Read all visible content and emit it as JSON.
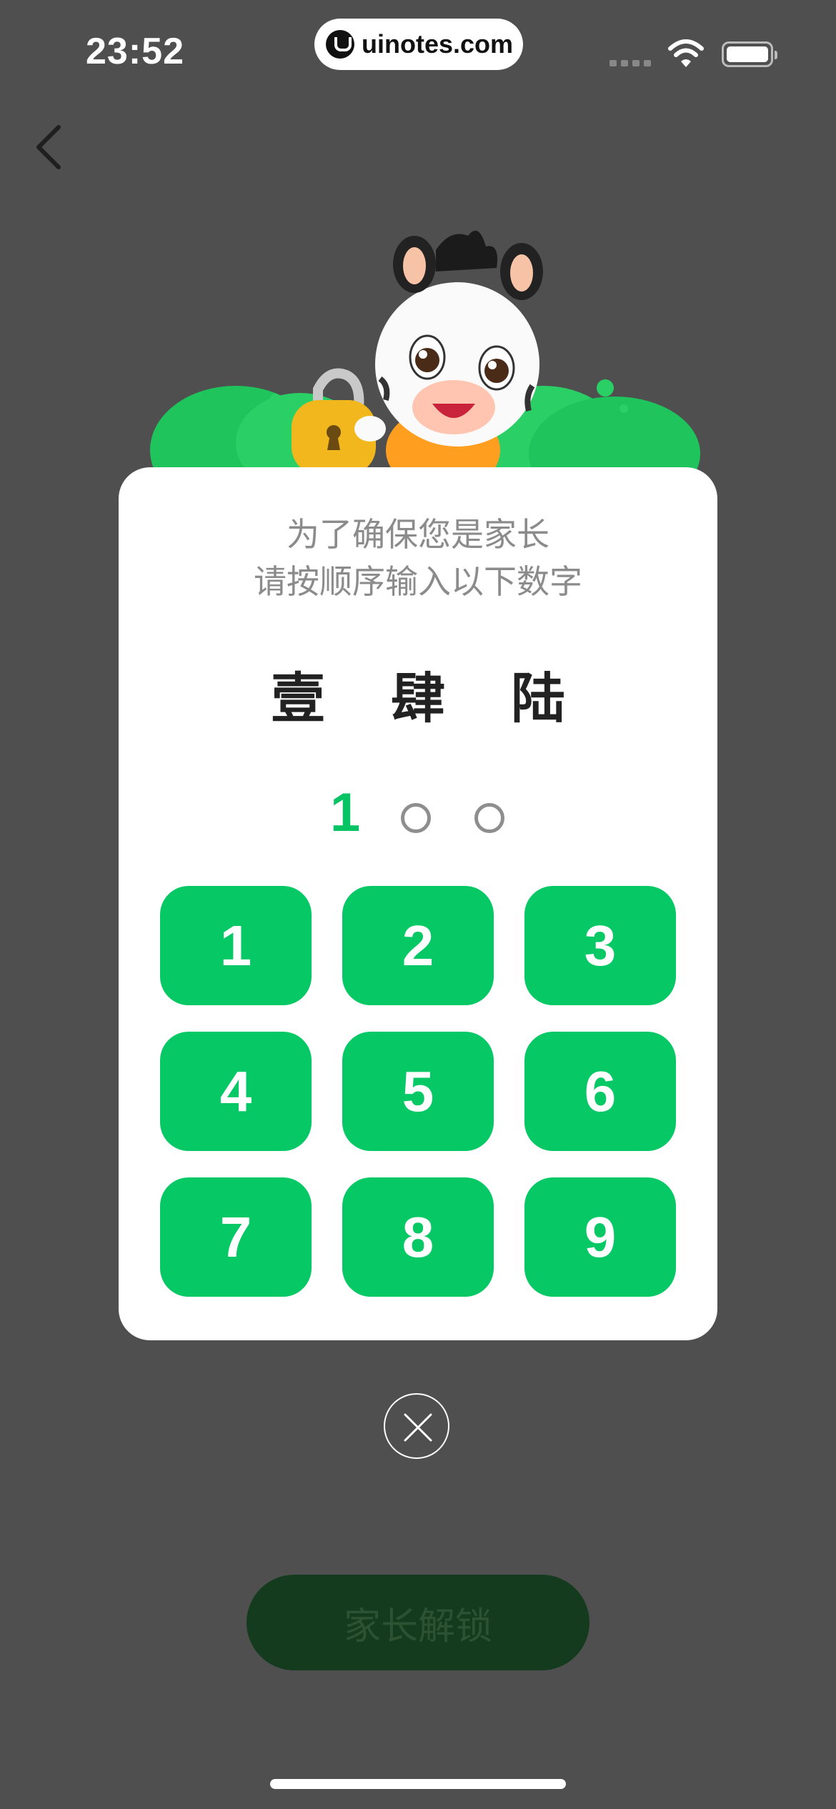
{
  "status_bar": {
    "time": "23:52",
    "url": "uinotes.com"
  },
  "prompt": {
    "line1": "为了确保您是家长",
    "line2": "请按顺序输入以下数字"
  },
  "challenge_chars": [
    "壹",
    "肆",
    "陆"
  ],
  "progress": {
    "entered_digit": "1",
    "entered_count": 1,
    "total": 3
  },
  "keypad": [
    "1",
    "2",
    "3",
    "4",
    "5",
    "6",
    "7",
    "8",
    "9"
  ],
  "unlock_button": {
    "label": "家长解锁"
  },
  "colors": {
    "accent": "#06c965",
    "overlay_bg": "#4f4f4f",
    "hint_text": "#8b8b8b"
  },
  "icons": {
    "back": "chevron-left-icon",
    "close": "close-icon",
    "mascot": "zebra-mascot-with-lock"
  }
}
